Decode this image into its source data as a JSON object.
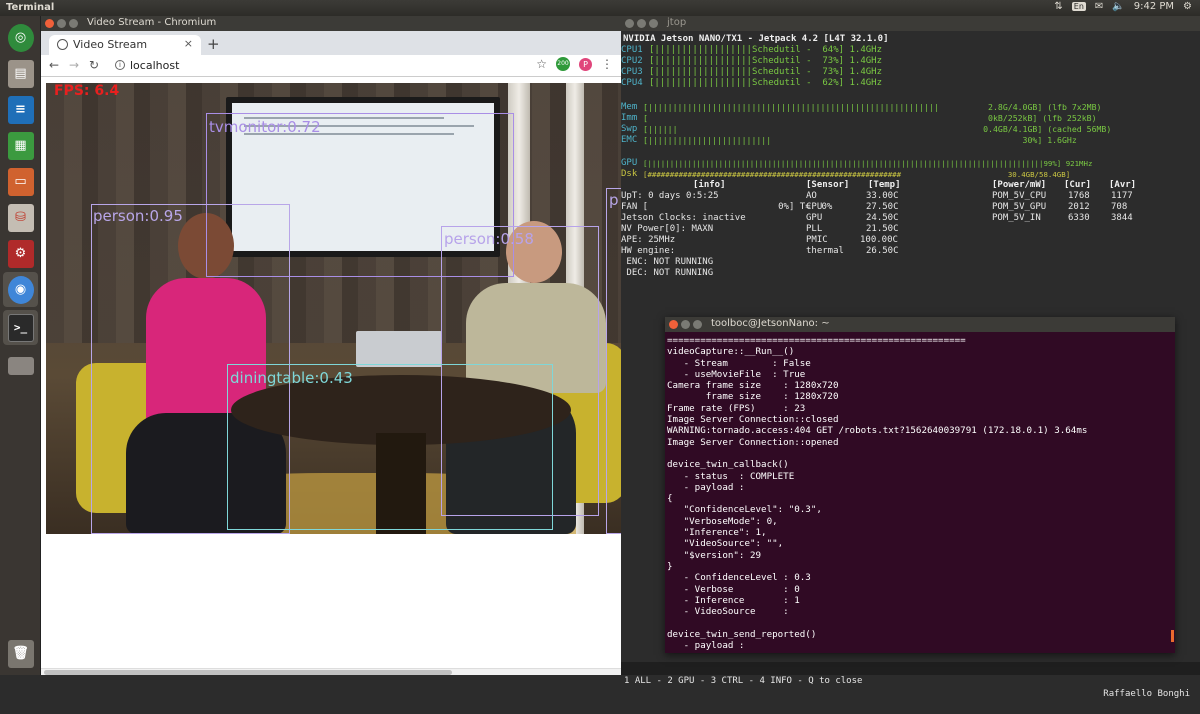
{
  "topbar": {
    "app_title": "Terminal",
    "lang": "En",
    "clock": "9:42 PM"
  },
  "launcher": {
    "items": [
      {
        "name": "ubuntu-dash-icon",
        "color": "#2f8b3c"
      },
      {
        "name": "files-icon",
        "color": "#8f8a82"
      },
      {
        "name": "writer-icon",
        "color": "#1f6fb8"
      },
      {
        "name": "calc-icon",
        "color": "#3b9a3f"
      },
      {
        "name": "impress-icon",
        "color": "#d0622f"
      },
      {
        "name": "software-center-icon",
        "color": "#c4bdb3"
      },
      {
        "name": "settings-icon",
        "color": "#b02a2a"
      },
      {
        "name": "chromium-icon",
        "color": "#3f86d8"
      },
      {
        "name": "terminal-icon",
        "color": "#2a2a2a"
      },
      {
        "name": "drive-icon",
        "color": "#8a8580"
      },
      {
        "name": "trash-icon",
        "color": "#7a766f"
      }
    ]
  },
  "chromium": {
    "window_title": "Video Stream - Chromium",
    "tab_title": "Video Stream",
    "tab_close": "×",
    "new_tab": "+",
    "url": "localhost",
    "extension_badge": "200",
    "profile_initial": "P",
    "nav": {
      "back": "←",
      "forward": "→",
      "reload": "↻",
      "star": "☆",
      "menu": "⋮"
    },
    "video": {
      "fps": "FPS: 6.4",
      "detections": [
        {
          "label": "tvmonitor:0.72",
          "color": "#a98ee6"
        },
        {
          "label": "person:0.95",
          "color": "#b8a6e8"
        },
        {
          "label": "person:0.58",
          "color": "#b7a3ea"
        },
        {
          "label": "diningtable:0.43",
          "color": "#7fd7d8"
        },
        {
          "label": "p",
          "color": "#b8a6e8"
        }
      ]
    }
  },
  "jtop": {
    "window_title": "jtop",
    "header": "NVIDIA Jetson NANO/TX1 - Jetpack 4.2 [L4T 32.1.0]",
    "cpus": [
      {
        "name": "CPU1",
        "bar": "[||||||||||||||||||Schedutil -  64%] 1.4GHz"
      },
      {
        "name": "CPU2",
        "bar": "[||||||||||||||||||Schedutil -  73%] 1.4GHz"
      },
      {
        "name": "CPU3",
        "bar": "[||||||||||||||||||Schedutil -  73%] 1.4GHz"
      },
      {
        "name": "CPU4",
        "bar": "[||||||||||||||||||Schedutil -  62%] 1.4GHz"
      }
    ],
    "mem": [
      {
        "name": "Mem",
        "bar": "[|||||||||||||||||||||||||||||||||||||||||||||||||||||||||||          2.8G/4.0GB] (lfb 7x2MB)"
      },
      {
        "name": "Imm",
        "bar": "[                                                                     0kB/252kB] (lfb 252kB)"
      },
      {
        "name": "Swp",
        "bar": "[||||||                                                              0.4GB/4.1GB] (cached 56MB)"
      },
      {
        "name": "EMC",
        "bar": "[|||||||||||||||||||||||||                                                   30%] 1.6GHz"
      }
    ],
    "gpu": {
      "name": "GPU",
      "bar": "[|||||||||||||||||||||||||||||||||||||||||||||||||||||||||||||||||||||||||||||||||||||||||99%] 921MHz"
    },
    "dsk": {
      "name": "Dsk",
      "bar": "[#########################################################                        30.4GB/58.4GB]"
    },
    "info": {
      "header": "[info]",
      "uptime": "UpT: 0 days 0:5:25",
      "fan": "FAN [                        0%] T=  0%",
      "clocks": "Jetson Clocks: inactive",
      "nvpower": "NV Power[0]: MAXN",
      "ape": "APE: 25MHz",
      "hw": "HW engine:",
      "enc": " ENC: NOT RUNNING",
      "dec": " DEC: NOT RUNNING"
    },
    "sensors": {
      "header_sensor": "[Sensor]",
      "header_temp": "[Temp]",
      "rows": [
        {
          "name": "AO",
          "temp": "33.00C"
        },
        {
          "name": "CPU",
          "temp": "27.50C"
        },
        {
          "name": "GPU",
          "temp": "24.50C"
        },
        {
          "name": "PLL",
          "temp": "21.50C"
        },
        {
          "name": "PMIC",
          "temp": "100.00C"
        },
        {
          "name": "thermal",
          "temp": "26.50C"
        }
      ]
    },
    "power": {
      "header_power": "[Power/mW]",
      "header_cur": "[Cur]",
      "header_avr": "[Avr]",
      "rows": [
        {
          "name": "POM_5V_CPU",
          "cur": "1768",
          "avr": "1177"
        },
        {
          "name": "POM_5V_GPU",
          "cur": "2012",
          "avr": "708"
        },
        {
          "name": "POM_5V_IN",
          "cur": "6330",
          "avr": "3844"
        }
      ]
    },
    "status_bar": "1 ALL - 2 GPU - 3 CTRL - 4 INFO - Q to close",
    "author": "Raffaello Bonghi"
  },
  "toolboc": {
    "window_title": "toolboc@JetsonNano: ~",
    "lines": [
      "======================================================",
      "videoCapture::__Run__()",
      "   - Stream        : False",
      "   - useMovieFile  : True",
      "Camera frame size    : 1280x720",
      "       frame size    : 1280x720",
      "Frame rate (FPS)     : 23",
      "Image Server Connection::closed",
      "WARNING:tornado.access:404 GET /robots.txt?1562640039791 (172.18.0.1) 3.64ms",
      "Image Server Connection::opened",
      "",
      "device_twin_callback()",
      "   - status  : COMPLETE",
      "   - payload :",
      "{",
      "   \"ConfidenceLevel\": \"0.3\",",
      "   \"VerboseMode\": 0,",
      "   \"Inference\": 1,",
      "   \"VideoSource\": \"\",",
      "   \"$version\": 29",
      "}",
      "   - ConfidenceLevel : 0.3",
      "   - Verbose         : 0",
      "   - Inference       : 1",
      "   - VideoSource     :",
      "",
      "device_twin_send_reported()",
      "   - payload :"
    ]
  }
}
